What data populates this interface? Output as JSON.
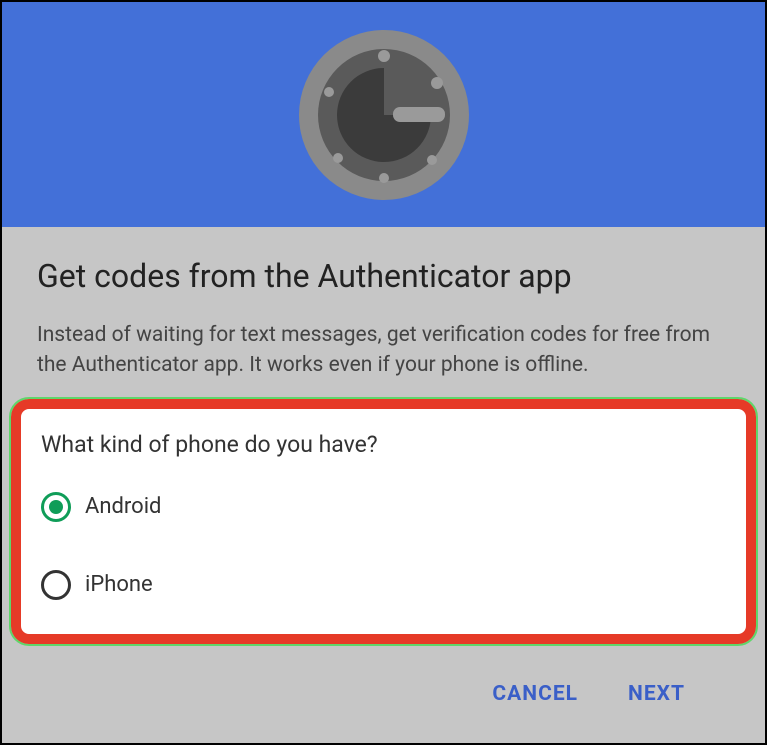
{
  "header": {
    "icon": "authenticator-vault-icon"
  },
  "content": {
    "title": "Get codes from the Authenticator app",
    "description": "Instead of waiting for text messages, get verification codes for free from the Authenticator app. It works even if your phone is offline."
  },
  "phoneSelection": {
    "question": "What kind of phone do you have?",
    "options": [
      {
        "label": "Android",
        "selected": true
      },
      {
        "label": "iPhone",
        "selected": false
      }
    ]
  },
  "footer": {
    "cancel_label": "CANCEL",
    "next_label": "NEXT"
  }
}
